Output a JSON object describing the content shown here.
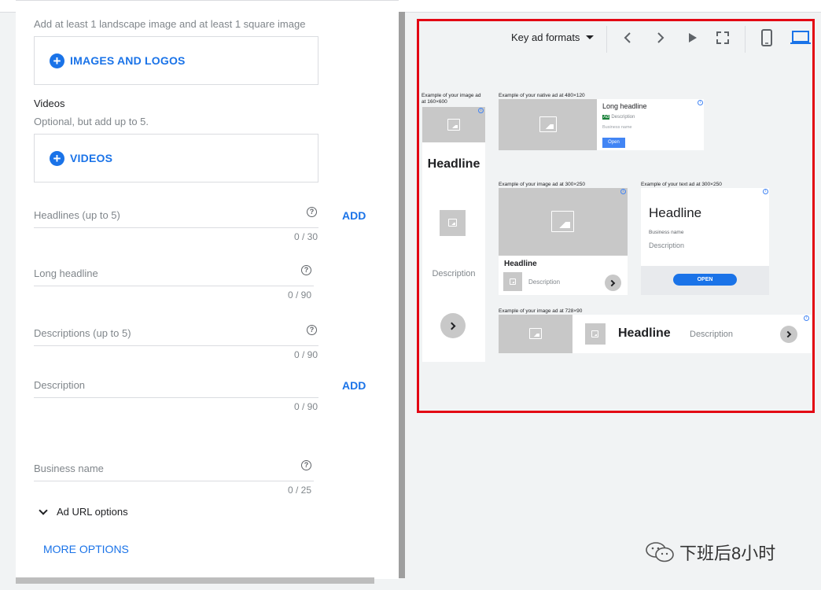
{
  "form": {
    "images_hint": "Add at least 1 landscape image and at least 1 square image",
    "images_button": "IMAGES AND LOGOS",
    "videos_label": "Videos",
    "videos_hint": "Optional, but add up to 5.",
    "videos_button": "VIDEOS",
    "fields": [
      {
        "label": "Headlines (up to 5)",
        "counter": "0 / 30",
        "add": "ADD"
      },
      {
        "label": "Long headline",
        "counter": "0 / 90"
      },
      {
        "label": "Descriptions (up to 5)",
        "counter": "0 / 90"
      },
      {
        "label": "Description",
        "counter": "0 / 90",
        "add": "ADD"
      },
      {
        "label": "Business name",
        "counter": "0 / 25"
      }
    ],
    "help_glyph": "?",
    "url_options": "Ad URL options",
    "more_options": "MORE OPTIONS"
  },
  "preview": {
    "format_select": "Key ad formats",
    "icons": [
      "chevron-left-icon",
      "chevron-right-icon",
      "play-icon",
      "fullscreen-icon",
      "phone-icon",
      "laptop-icon"
    ],
    "accent": "#1a73e8",
    "highlight_border": "#e30613",
    "ads": {
      "a160": {
        "caption": "Example of your image ad at 160×600",
        "headline": "Headline",
        "description": "Description"
      },
      "native": {
        "caption": "Example of your native ad at 480×120",
        "headline": "Long headline",
        "badge": "Ad",
        "description": "Description",
        "business": "Business name",
        "button": "Open"
      },
      "img300": {
        "caption": "Example of your image ad at 300×250",
        "headline": "Headline",
        "description": "Description"
      },
      "text300": {
        "caption": "Example of your text ad at 300×250",
        "headline": "Headline",
        "business": "Business name",
        "description": "Description",
        "button": "OPEN"
      },
      "banner": {
        "caption": "Example of your image ad at 728×90",
        "headline": "Headline",
        "description": "Description"
      }
    }
  },
  "watermark": "下班后8小时"
}
